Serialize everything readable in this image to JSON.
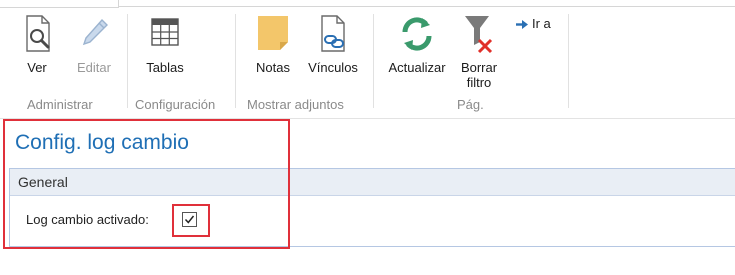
{
  "ribbon": {
    "buttons": {
      "ver": {
        "label": "Ver",
        "icon": "magnifier-document-icon"
      },
      "editar": {
        "label": "Editar",
        "icon": "pencil-icon",
        "disabled": true
      },
      "tablas": {
        "label": "Tablas",
        "icon": "table-icon"
      },
      "notas": {
        "label": "Notas",
        "icon": "sticky-note-icon"
      },
      "vinculos": {
        "label": "Vínculos",
        "icon": "document-link-icon"
      },
      "actualizar": {
        "label": "Actualizar",
        "icon": "refresh-icon"
      },
      "borrar_filtro": {
        "label_line1": "Borrar",
        "label_line2": "filtro",
        "icon": "clear-filter-icon"
      },
      "ir_a": {
        "label": "Ir a",
        "icon": "arrow-right-icon"
      }
    },
    "groups": {
      "administrar": "Administrar",
      "configuracion": "Configuración",
      "mostrar_adjuntos": "Mostrar adjuntos",
      "pag": "Pág."
    }
  },
  "page": {
    "title": "Config. log cambio",
    "fasttab_title": "General",
    "field": {
      "label": "Log cambio activado:",
      "checked": true
    }
  },
  "colors": {
    "title_blue": "#1f6fb5",
    "highlight_red": "#e0303a",
    "refresh_green": "#3a9a6c",
    "note_yellow": "#f3c66a"
  }
}
